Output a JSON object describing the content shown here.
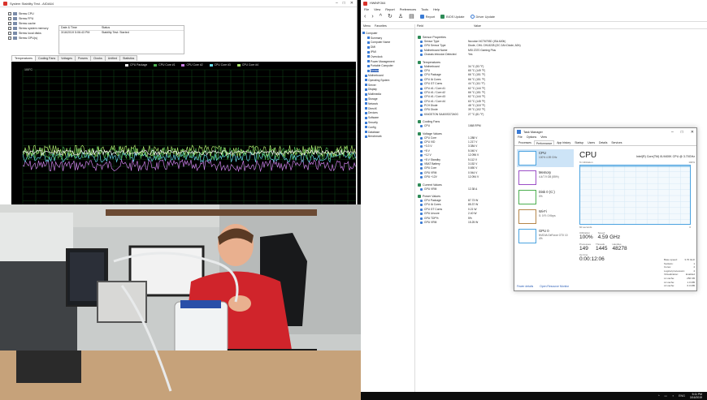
{
  "stress_window": {
    "title": "System Stability Test - AIDA64",
    "checks": [
      {
        "label": "Stress CPU"
      },
      {
        "label": "Stress FPU"
      },
      {
        "label": "Stress cache"
      },
      {
        "label": "Stress system memory"
      },
      {
        "label": "Stress local disks"
      },
      {
        "label": "Stress GPU(s)"
      }
    ],
    "event_table": {
      "col_date": "Date & Time",
      "col_status": "Status",
      "row_date": "3/16/2019 5:06:43 PM",
      "row_status": "Stability Test: Started"
    },
    "tabs": [
      "Temperatures",
      "Cooling Fans",
      "Voltages",
      "Powers",
      "Clocks",
      "Unified",
      "Statistics"
    ],
    "graph": {
      "y_max_label": "100°C",
      "legend": [
        {
          "name": "CPU Package",
          "color": "#f5f5f5"
        },
        {
          "name": "CPU Core #1",
          "color": "#4caf50"
        },
        {
          "name": "CPU Core #2",
          "color": "#c97ee6"
        },
        {
          "name": "CPU Core #3",
          "color": "#66d9e8"
        },
        {
          "name": "CPU Core #4",
          "color": "#a9e26b"
        }
      ]
    }
  },
  "hwmon": {
    "title": "HWiNFO64",
    "menu": [
      "File",
      "View",
      "Report",
      "Preferences",
      "Tools",
      "Help"
    ],
    "toolbar": {
      "report": "Report",
      "bios_update": "BIOS Update",
      "driver_update": "Driver Update"
    },
    "columns": {
      "menu": "Menu",
      "favorites": "Favorites",
      "field": "Field",
      "value": "Value"
    },
    "tree": [
      {
        "label": "Computer",
        "selected": false
      },
      {
        "label": "Summary",
        "selected": false
      },
      {
        "label": "Computer Name",
        "selected": false
      },
      {
        "label": "DMI",
        "selected": false
      },
      {
        "label": "IPMI",
        "selected": false
      },
      {
        "label": "Overclock",
        "selected": false
      },
      {
        "label": "Power Management",
        "selected": false
      },
      {
        "label": "Portable Computer",
        "selected": false
      },
      {
        "label": "Sensor",
        "selected": true
      },
      {
        "label": "Motherboard",
        "selected": false
      },
      {
        "label": "Operating System",
        "selected": false
      },
      {
        "label": "Server",
        "selected": false
      },
      {
        "label": "Display",
        "selected": false
      },
      {
        "label": "Multimedia",
        "selected": false
      },
      {
        "label": "Storage",
        "selected": false
      },
      {
        "label": "Network",
        "selected": false
      },
      {
        "label": "DirectX",
        "selected": false
      },
      {
        "label": "Devices",
        "selected": false
      },
      {
        "label": "Software",
        "selected": false
      },
      {
        "label": "Security",
        "selected": false
      },
      {
        "label": "Config",
        "selected": false
      },
      {
        "label": "Database",
        "selected": false
      },
      {
        "label": "Benchmark",
        "selected": false
      }
    ],
    "sections": [
      {
        "title": "Sensor Properties",
        "rows": [
          [
            "Sensor Type",
            "Nuvoton NCT6793D (ISA A00h)"
          ],
          [
            "GPU Sensor Type",
            "Diode, CHiL CHL8228 (I2C 2Ah Diode, A0h)"
          ],
          [
            "Motherboard Name",
            "MSI Z370 Gaming Plus"
          ],
          [
            "Chassis Intrusion Detected",
            "Yes"
          ]
        ]
      },
      {
        "title": "Temperatures",
        "rows": [
          [
            "Motherboard",
            "34 °C (93 °F)"
          ],
          [
            "CPU",
            "65 °C (149 °F)"
          ],
          [
            "CPU Package",
            "66 °C (151 °F)"
          ],
          [
            "CPU IA Cores",
            "66 °C (151 °F)"
          ],
          [
            "CPU GT Cores",
            "44 °C (111 °F)"
          ],
          [
            "CPU #1 / Core #1",
            "62 °C (144 °F)"
          ],
          [
            "CPU #1 / Core #2",
            "66 °C (151 °F)"
          ],
          [
            "CPU #1 / Core #3",
            "62 °C (144 °F)"
          ],
          [
            "CPU #1 / Core #4",
            "63 °C (145 °F)"
          ],
          [
            "PCH Diode",
            "48 °C (118 °F)"
          ],
          [
            "GPU Diode",
            "39 °C (102 °F)"
          ],
          [
            "KINGSTON SA400S37240G",
            "27 °C (81 °F)"
          ]
        ]
      },
      {
        "title": "Cooling Fans",
        "rows": [
          [
            "CPU",
            "1068 RPM"
          ]
        ]
      },
      {
        "title": "Voltage Values",
        "rows": [
          [
            "CPU Core",
            "1.288 V"
          ],
          [
            "CPU VID",
            "1.217 V"
          ],
          [
            "+3.3 V",
            "3.384 V"
          ],
          [
            "+5 V",
            "5.040 V"
          ],
          [
            "+12 V",
            "12.096 V"
          ],
          [
            "+5 V Standby",
            "5.112 V"
          ],
          [
            "VBAT Battery",
            "3.152 V"
          ],
          [
            "GPU Core",
            "0.650 V"
          ],
          [
            "GPU VRM",
            "0.944 V"
          ],
          [
            "GPU +12V",
            "12.094 V"
          ]
        ]
      },
      {
        "title": "Current Values",
        "rows": [
          [
            "GPU VRM",
            "12.38 A"
          ]
        ]
      },
      {
        "title": "Power Values",
        "rows": [
          [
            "CPU Package",
            "87.73 W"
          ],
          [
            "CPU IA Cores",
            "85.37 W"
          ],
          [
            "CPU GT Cores",
            "0.21 W"
          ],
          [
            "GPU Uncore",
            "2.40 W"
          ],
          [
            "GPU TDP%",
            "5%"
          ],
          [
            "GPU VRM",
            "15.25 W"
          ]
        ]
      }
    ]
  },
  "taskmgr": {
    "title": "Task Manager",
    "menu": [
      "File",
      "Options",
      "View"
    ],
    "tabs": [
      "Processes",
      "Performance",
      "App history",
      "Startup",
      "Users",
      "Details",
      "Services"
    ],
    "active_tab": "Performance",
    "side": [
      {
        "name": "CPU",
        "sub": "100% 4.59 GHz",
        "color": "#4ba3e0",
        "active": true
      },
      {
        "name": "Memory",
        "sub": "4.4/7.9 GB (55%)",
        "color": "#9c4fc7",
        "active": false
      },
      {
        "name": "Disk 0 (C:)",
        "sub": "0%",
        "color": "#4caf50",
        "active": false
      },
      {
        "name": "Wi-Fi",
        "sub": "S: 0 R: 0 Kbps",
        "color": "#b5864a",
        "active": false
      },
      {
        "name": "GPU 0",
        "sub": "NVIDIA GeForce GTX 10 4%",
        "color": "#4ba3e0",
        "active": false
      }
    ],
    "cpu_title": "CPU",
    "cpu_model": "Intel(R) Core(TM) i5-9400K CPU @ 3.70GHz",
    "util_label": "% Utilization",
    "util_max": "100%",
    "graph_left": "60 seconds",
    "graph_right": "0",
    "stats": {
      "utilization_label": "Utilization",
      "utilization": "100%",
      "speed_label": "Speed",
      "speed": "4.59 GHz",
      "processes_label": "Processes",
      "processes": "149",
      "threads_label": "Threads",
      "threads": "1445",
      "handles_label": "Handles",
      "handles": "48278",
      "uptime_label": "Up time",
      "uptime": "0:00:12:06"
    },
    "details": [
      [
        "Base speed:",
        "3.70 GHz"
      ],
      [
        "Sockets:",
        "1"
      ],
      [
        "Cores:",
        "4"
      ],
      [
        "Logical processors:",
        "4"
      ],
      [
        "Virtualization:",
        "Enabled"
      ],
      [
        "L1 cache:",
        "256 KB"
      ],
      [
        "L2 cache:",
        "1.0 MB"
      ],
      [
        "L3 cache:",
        "6.0 MB"
      ]
    ],
    "footer": {
      "fewer": "Fewer details",
      "open_rm": "Open Resource Monitor"
    }
  },
  "taskbar": {
    "time": "5:11 PM",
    "date": "3/16/2019",
    "lang": "ENG"
  }
}
